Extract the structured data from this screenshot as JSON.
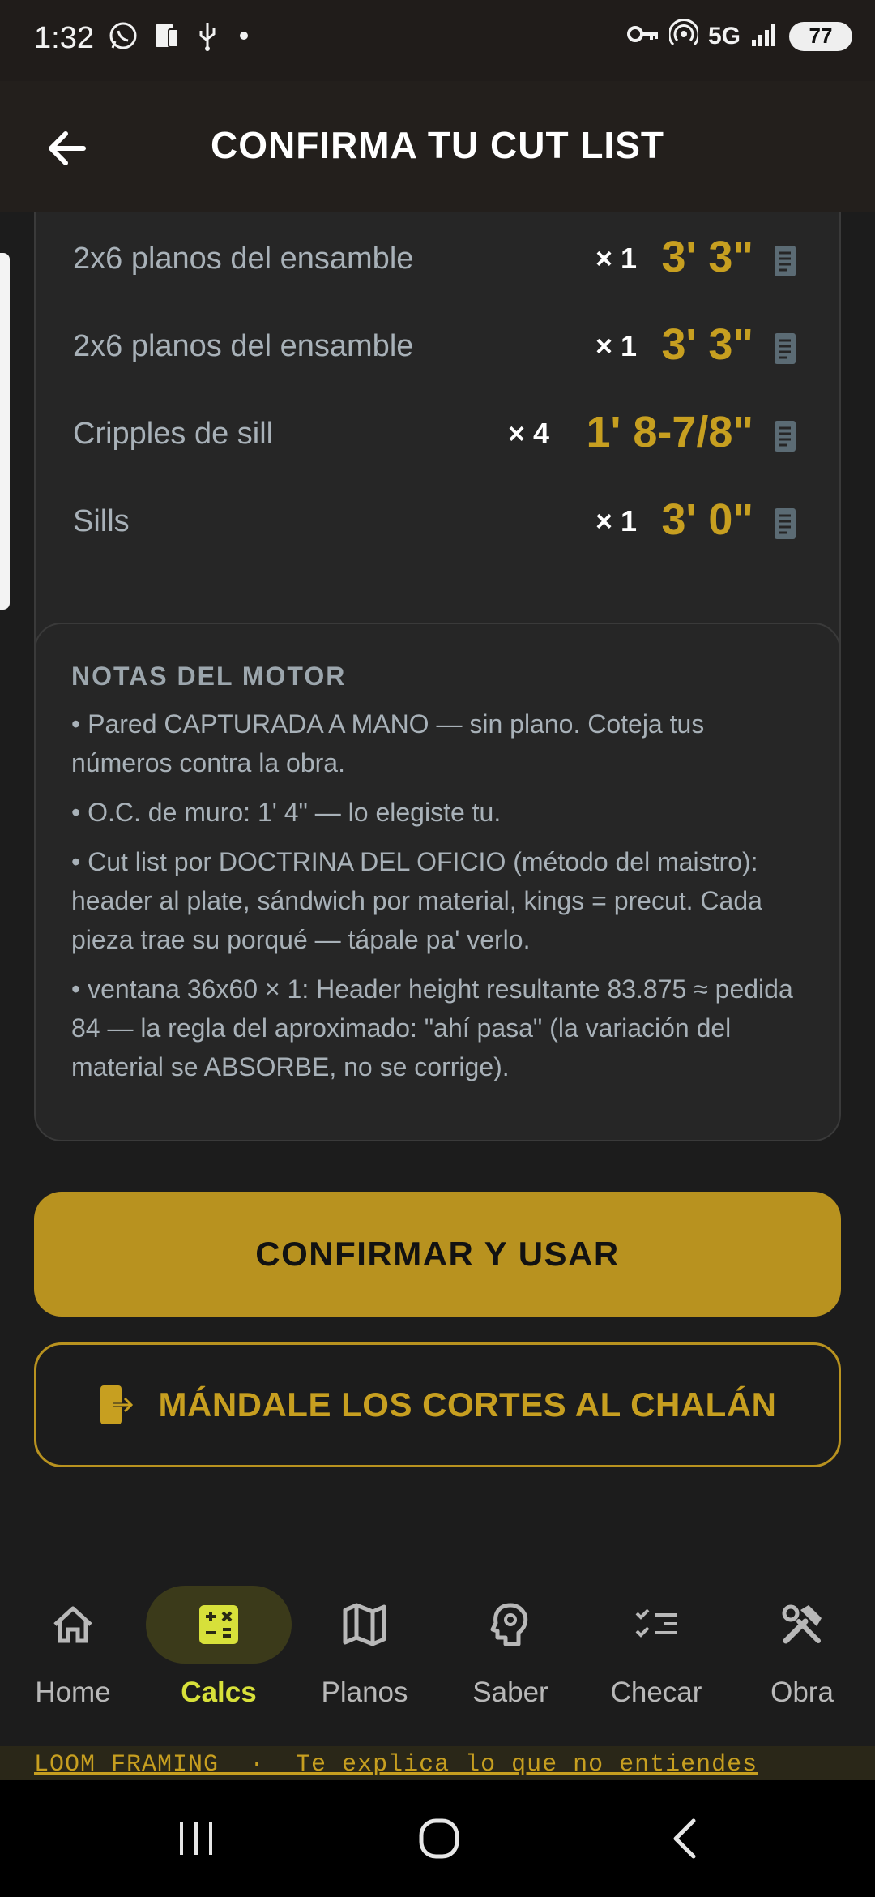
{
  "status_bar": {
    "time": "1:32",
    "network": "5G",
    "battery": "77",
    "left_icons": [
      "whatsapp-icon",
      "sim-icon",
      "usb-icon",
      "dot-icon"
    ],
    "right_icons": [
      "key-icon",
      "hotspot-icon",
      "signal-icon",
      "battery-icon"
    ]
  },
  "app_bar": {
    "title": "CONFIRMA TU CUT LIST"
  },
  "cut_list": [
    {
      "label": "2x6 planos del ensamble",
      "qty": "× 1",
      "measure": "3' 3\""
    },
    {
      "label": "2x6 planos del ensamble",
      "qty": "× 1",
      "measure": "3' 3\""
    },
    {
      "label": "Cripples de sill",
      "qty": "× 4",
      "measure": "1' 8-7/8\""
    },
    {
      "label": "Sills",
      "qty": "× 1",
      "measure": "3' 0\""
    }
  ],
  "notes": {
    "title": "NOTAS DEL MOTOR",
    "items": [
      "• Pared CAPTURADA A MANO — sin plano. Coteja tus números contra la obra.",
      "• O.C. de muro: 1' 4\" — lo elegiste tu.",
      "• Cut list por DOCTRINA DEL OFICIO (método del maistro): header al plate, sándwich por material, kings = precut. Cada pieza trae su porqué — tápale pa' verlo.",
      "• ventana 36x60 × 1: Header height resultante 83.875 ≈ pedida 84 — la regla del aproximado: \"ahí pasa\" (la variación del material se ABSORBE, no se corrige)."
    ]
  },
  "actions": {
    "confirm_label": "CONFIRMAR Y USAR",
    "send_label": "MÁNDALE LOS CORTES AL CHALÁN"
  },
  "bottom_nav": {
    "active": "Calcs",
    "items": [
      {
        "label": "Home",
        "icon": "home-icon"
      },
      {
        "label": "Calcs",
        "icon": "calculator-icon"
      },
      {
        "label": "Planos",
        "icon": "map-icon"
      },
      {
        "label": "Saber",
        "icon": "brain-gear-icon"
      },
      {
        "label": "Checar",
        "icon": "checklist-icon"
      },
      {
        "label": "Obra",
        "icon": "tools-icon"
      }
    ]
  },
  "footer": {
    "text": "LOOM FRAMING  ·  Te explica lo que no entiendes"
  },
  "colors": {
    "accent": "#c79f20",
    "active_nav": "#d7e03a",
    "background": "#1c1c1c"
  }
}
